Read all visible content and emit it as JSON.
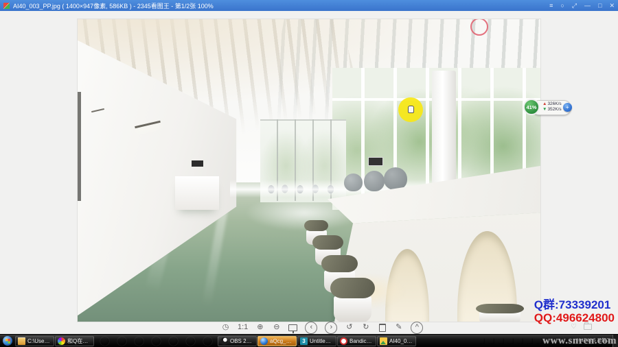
{
  "titlebar": {
    "title": "AI40_003_PP.jpg ( 1400×947像素, 586KB ) - 2345看图王 - 第1/2张 100%",
    "controls": [
      {
        "name": "menu-button",
        "glyph": "≡"
      },
      {
        "name": "loop-button",
        "glyph": "○"
      },
      {
        "name": "fullscreen-button",
        "glyph": "⤢"
      },
      {
        "name": "minimize-button",
        "glyph": "—"
      },
      {
        "name": "maximize-button",
        "glyph": "□"
      },
      {
        "name": "close-button",
        "glyph": "✕"
      }
    ]
  },
  "viewer": {
    "zoom_level": "100%",
    "toolbar": [
      {
        "name": "browse-history-button",
        "glyph": "◷"
      },
      {
        "name": "actual-size-button",
        "glyph": "1:1"
      },
      {
        "name": "zoom-in-button",
        "glyph": "⊕"
      },
      {
        "name": "zoom-out-button",
        "glyph": "⊖"
      },
      {
        "name": "slideshow-button",
        "shape": "screen"
      },
      {
        "name": "previous-image-button",
        "glyph": "‹",
        "circled": true
      },
      {
        "name": "next-image-button",
        "glyph": "›",
        "circled": true
      },
      {
        "name": "rotate-left-button",
        "glyph": "↺"
      },
      {
        "name": "rotate-right-button",
        "glyph": "↻"
      },
      {
        "name": "delete-button",
        "shape": "trash"
      },
      {
        "name": "edit-button",
        "glyph": "✎"
      },
      {
        "name": "collapse-toolbar-button",
        "glyph": "^",
        "circled": true
      }
    ],
    "net_widget": {
      "percent": "41%",
      "up_arrow": "▲",
      "upload": "326K/s",
      "down_arrow": "▼",
      "download": "352K/s",
      "boost_glyph": "+"
    }
  },
  "overlay": {
    "qq_group": "Q群:73339201",
    "qq_number": "QQ:496624800",
    "heart_glyph": "♡",
    "watermark": "www.snren.com"
  },
  "taskbar": {
    "buttons_left": [
      {
        "name": "taskbar-button-explorer",
        "icon": "folder",
        "label": "C:\\Users\\..."
      },
      {
        "name": "taskbar-button-pinwheel-app",
        "icon": "pinwheel",
        "label": "和Q在显..."
      }
    ],
    "buttons_mid": [
      {
        "name": "taskbar-button-obs",
        "icon": "obs",
        "label": "OBS 20.1..."
      },
      {
        "name": "taskbar-button-viewer-active",
        "icon": "sphere",
        "label": "aQcg_Vip...",
        "active": true
      },
      {
        "name": "taskbar-button-3dsmax",
        "icon": "max3",
        "label": "Untitled - ..."
      },
      {
        "name": "taskbar-button-bandicam",
        "icon": "bandicam",
        "label": "Bandicam"
      },
      {
        "name": "taskbar-button-image-file",
        "icon": "pictures",
        "label": "AI40_001_..."
      }
    ],
    "quick_icons": [
      {
        "name": "bird-icon",
        "color": "#38a8e8"
      },
      {
        "name": "orb-icon",
        "color": "#3b6fd4"
      },
      {
        "name": "cursor-arrow-icon",
        "color": "#e170a8"
      },
      {
        "name": "browser-icon",
        "color": "#2e7cd6"
      },
      {
        "name": "flame-icon",
        "color": "#c8762a"
      },
      {
        "name": "moon-icon",
        "color": "#35518e"
      },
      {
        "name": "pill-icon",
        "color": "#d04038"
      }
    ],
    "tray_icons": [
      {
        "name": "tray-icon-1",
        "color": "#5aa0e8"
      },
      {
        "name": "tray-icon-2",
        "color": "#2f2f2f"
      },
      {
        "name": "tray-icon-3",
        "color": "#d43838"
      },
      {
        "name": "tray-icon-4",
        "color": "#2e7cd6"
      },
      {
        "name": "tray-icon-5",
        "color": "#44a048"
      },
      {
        "name": "tray-icon-6",
        "color": "#e89028"
      },
      {
        "name": "tray-icon-7",
        "color": "#d43838"
      },
      {
        "name": "tray-icon-8",
        "color": "#7ac043"
      },
      {
        "name": "tray-icon-9",
        "color": "#28a8c8"
      },
      {
        "name": "tray-icon-10",
        "color": "#e8e044"
      }
    ],
    "clock": "2017/12/5 星期二"
  }
}
